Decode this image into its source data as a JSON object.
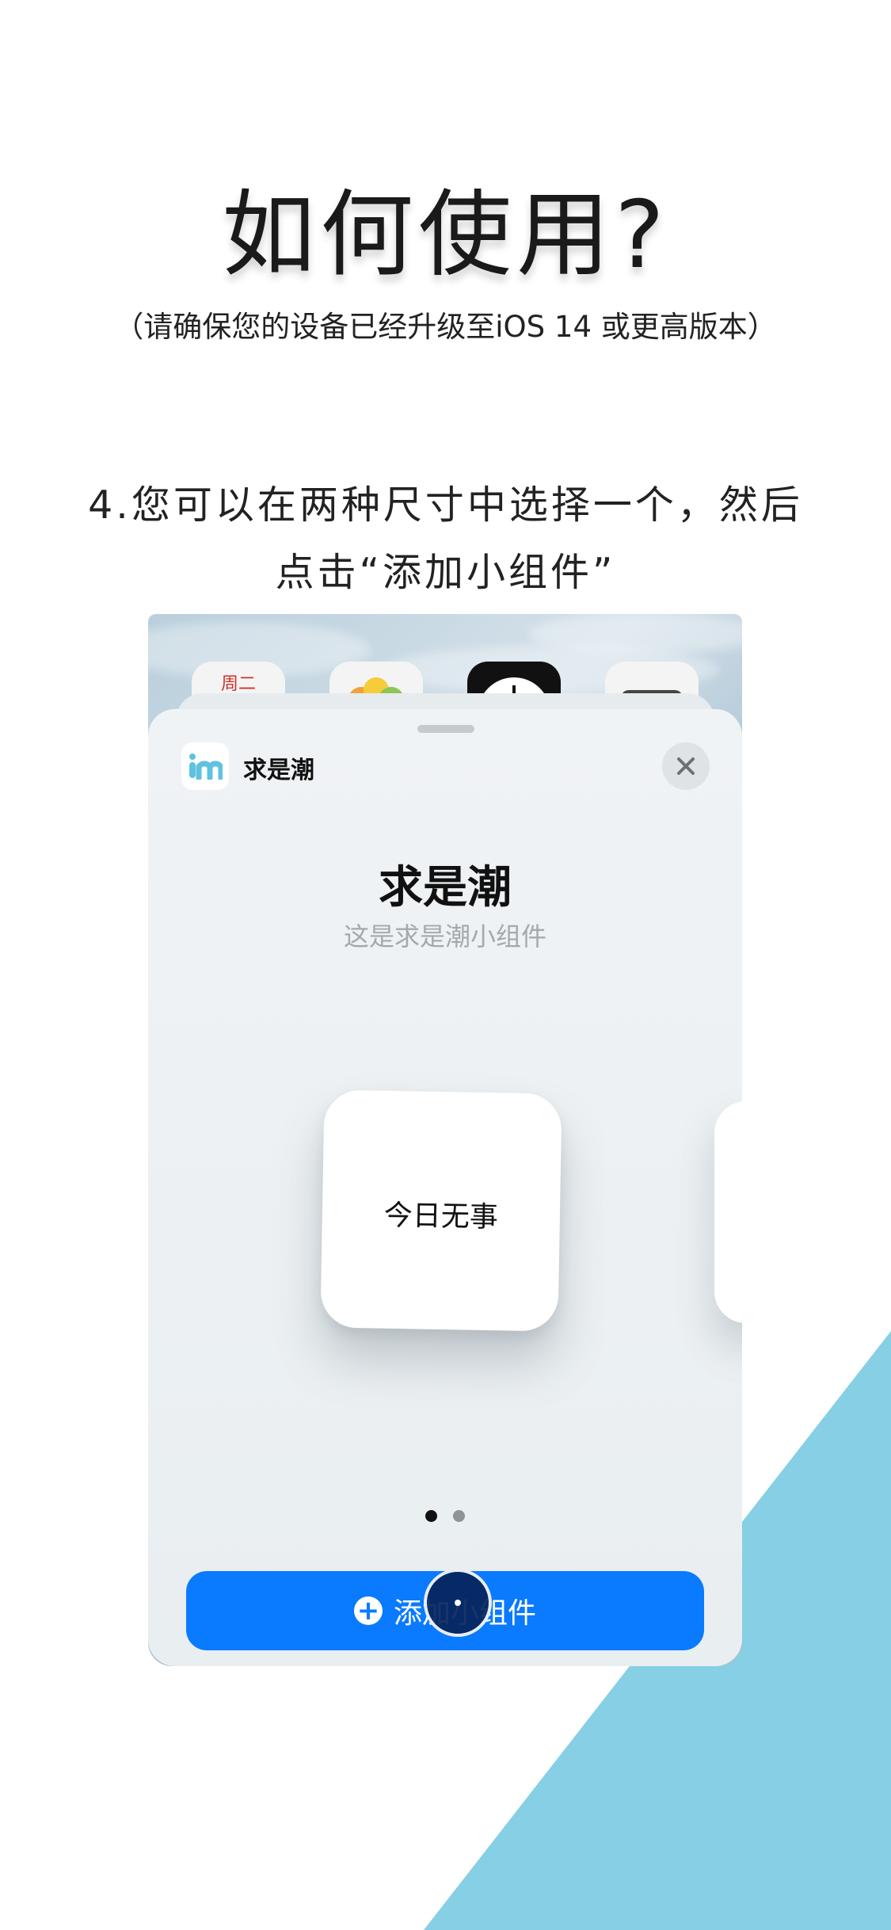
{
  "page": {
    "title": "如何使用?",
    "subtitle": "（请确保您的设备已经升级至iOS 14 或更高版本）",
    "step_line1": "4.您可以在两种尺寸中选择一个，然后",
    "step_line2": "点击“添加小组件”"
  },
  "colors": {
    "accent": "#0a7aff",
    "decor_band": "#86cfe4",
    "sheet": "#eef2f4"
  },
  "home_screen": {
    "calendar_label": "周二",
    "icons": [
      "calendar-icon",
      "photos-icon",
      "clock-icon",
      "camera-icon"
    ]
  },
  "sheet": {
    "app_name": "求是潮",
    "widget_title": "求是潮",
    "widget_description": "这是求是潮小组件",
    "widget_text": "今日无事",
    "page_indicator": {
      "count": 2,
      "current": 1
    },
    "add_button_label": "添加小组件"
  }
}
